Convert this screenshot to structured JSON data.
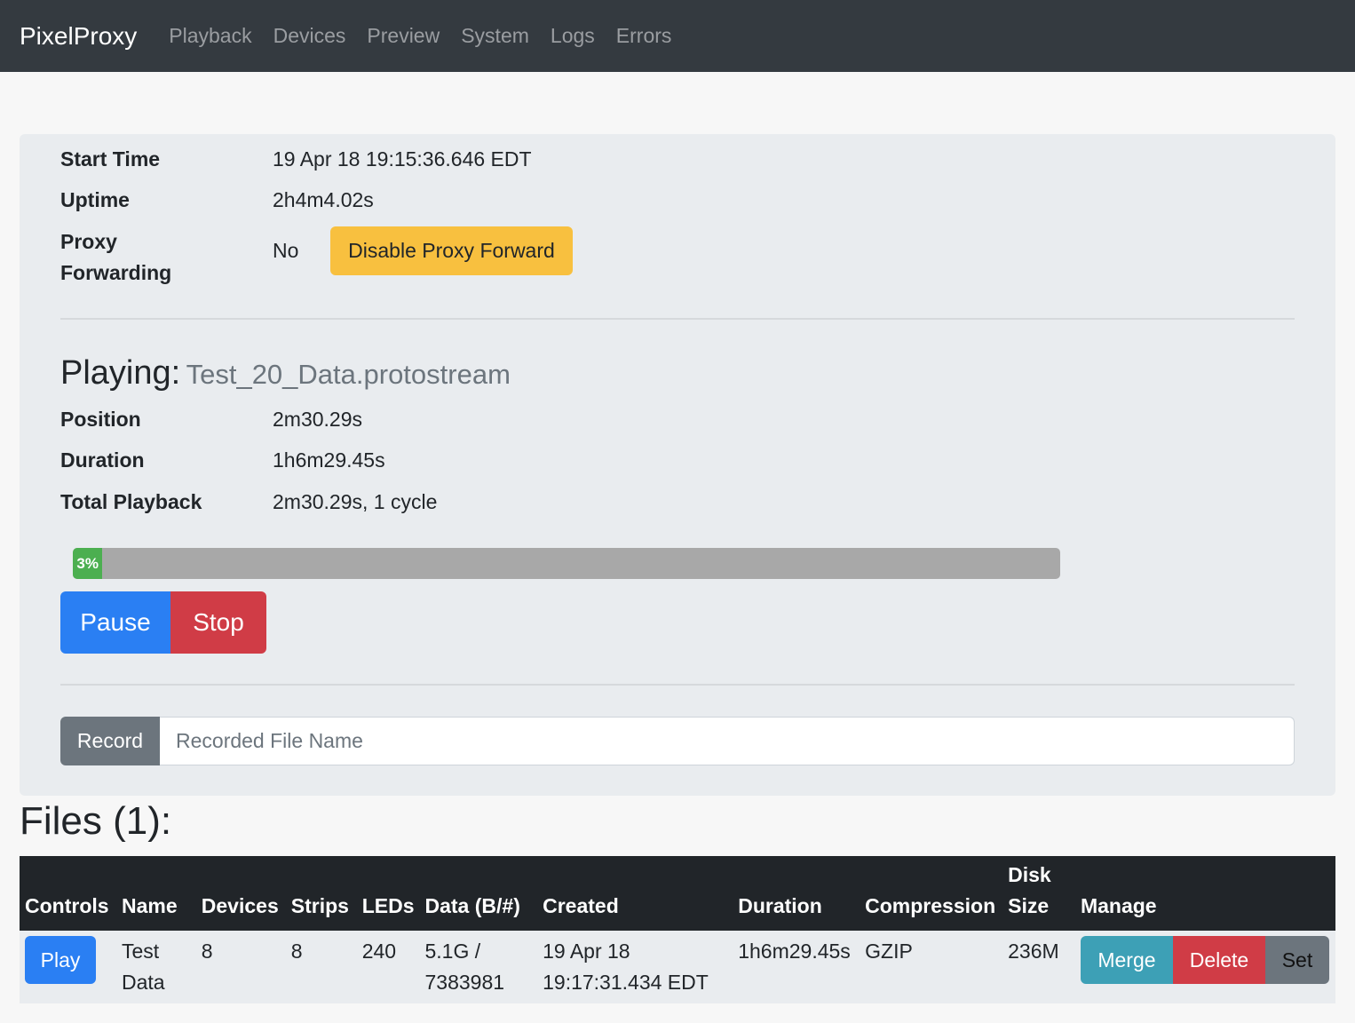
{
  "nav": {
    "brand": "PixelProxy",
    "items": [
      "Playback",
      "Devices",
      "Preview",
      "System",
      "Logs",
      "Errors"
    ]
  },
  "status": {
    "start_time_label": "Start Time",
    "start_time": "19 Apr 18 19:15:36.646 EDT",
    "uptime_label": "Uptime",
    "uptime": "2h4m4.02s",
    "proxy_label_line1": "Proxy",
    "proxy_label_line2": "Forwarding",
    "proxy_value": "No",
    "proxy_button": "Disable Proxy Forward"
  },
  "playing": {
    "heading": "Playing:",
    "file": "Test_20_Data.protostream",
    "position_label": "Position",
    "position": "2m30.29s",
    "duration_label": "Duration",
    "duration": "1h6m29.45s",
    "total_label": "Total Playback",
    "total": "2m30.29s, 1 cycle",
    "progress_percent": 3,
    "progress_label": "3%",
    "pause_button": "Pause",
    "stop_button": "Stop"
  },
  "record": {
    "label": "Record",
    "placeholder": "Recorded File Name"
  },
  "files": {
    "heading": "Files (1):",
    "columns": [
      "Controls",
      "Name",
      "Devices",
      "Strips",
      "LEDs",
      "Data (B/#)",
      "Created",
      "Duration",
      "Compression",
      "Disk Size",
      "Manage"
    ],
    "rows": [
      {
        "play": "Play",
        "name": "Test Data",
        "devices": "8",
        "strips": "8",
        "leds": "240",
        "data": "5.1G / 7383981",
        "created": "19 Apr 18 19:17:31.434 EDT",
        "duration": "1h6m29.45s",
        "compression": "GZIP",
        "disk_size": "236M",
        "merge": "Merge",
        "delete": "Delete",
        "set": "Set"
      }
    ]
  },
  "colors": {
    "navbar": "#343a40",
    "primary": "#2a7ff3",
    "danger": "#d03c46",
    "warning": "#f8c03f",
    "info": "#3da0b6",
    "secondary": "#6c757d",
    "progress": "#4caf50"
  }
}
